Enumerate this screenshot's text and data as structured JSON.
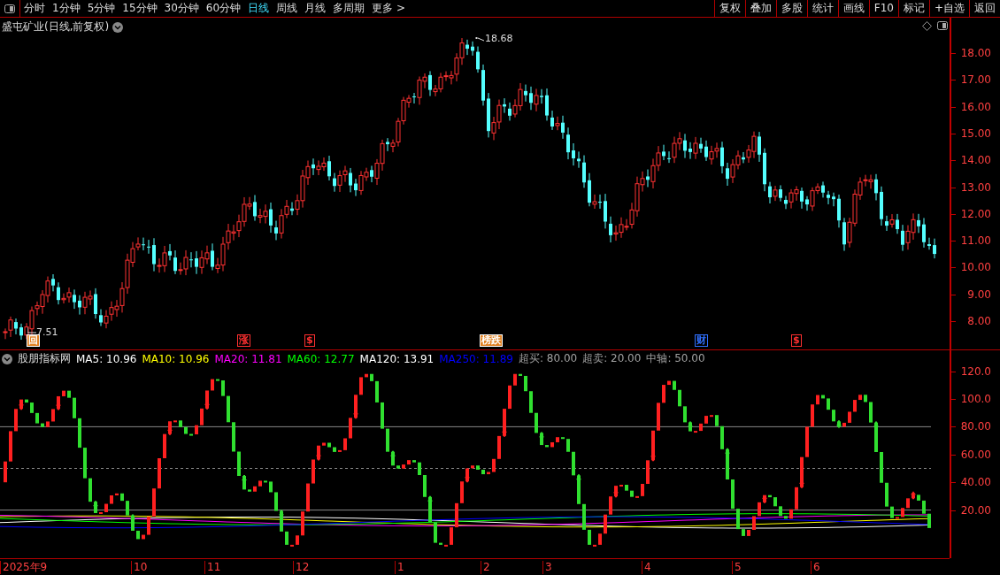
{
  "toolbar": {
    "periods": [
      {
        "label": "分时",
        "selected": false
      },
      {
        "label": "1分钟",
        "selected": false
      },
      {
        "label": "5分钟",
        "selected": false
      },
      {
        "label": "15分钟",
        "selected": false
      },
      {
        "label": "30分钟",
        "selected": false
      },
      {
        "label": "60分钟",
        "selected": false
      },
      {
        "label": "日线",
        "selected": true
      },
      {
        "label": "周线",
        "selected": false
      },
      {
        "label": "月线",
        "selected": false
      },
      {
        "label": "多周期",
        "selected": false
      },
      {
        "label": "更多 >",
        "selected": false
      }
    ],
    "buttons": [
      "复权",
      "叠加",
      "多股",
      "统计",
      "画线",
      "F10",
      "标记",
      "+自选",
      "返回"
    ]
  },
  "price_chart": {
    "title": "盛屯矿业(日线,前复权)",
    "high_label": "18.68",
    "low_label": "7.51",
    "axis_ticks": [
      "18.00",
      "17.00",
      "16.00",
      "15.00",
      "14.00",
      "13.00",
      "12.00",
      "11.00",
      "10.00",
      "9.00",
      "8.00"
    ],
    "events": [
      {
        "text": "回",
        "color": "#e08020"
      },
      {
        "text": "涨",
        "color": "#ff3030"
      },
      {
        "text": "$",
        "color": "#ff3030"
      },
      {
        "text": "榜跌",
        "color": "#e08020"
      },
      {
        "text": "财",
        "color": "#3070ff"
      },
      {
        "text": "$",
        "color": "#ff3030"
      }
    ]
  },
  "indicator": {
    "name": "股朋指标网",
    "fields": [
      {
        "text": "MA5: 10.96",
        "color": "#ffffff"
      },
      {
        "text": "MA10: 10.96",
        "color": "#ffff00"
      },
      {
        "text": "MA20: 11.81",
        "color": "#ff00ff"
      },
      {
        "text": "MA60: 12.77",
        "color": "#00ff00"
      },
      {
        "text": "MA120: 13.91",
        "color": "#ffffff"
      },
      {
        "text": "MA250: 11.89",
        "color": "#0000ff"
      },
      {
        "text": "超买: 80.00",
        "color": "#a0a0a0"
      },
      {
        "text": "超卖: 20.00",
        "color": "#a0a0a0"
      },
      {
        "text": "中轴: 50.00",
        "color": "#a0a0a0"
      }
    ],
    "axis_ticks": [
      "120.0",
      "100.0",
      "80.00",
      "60.00",
      "40.00",
      "20.00"
    ]
  },
  "date_axis": [
    "2025年9",
    "10",
    "11",
    "12",
    "1",
    "2",
    "3",
    "4",
    "5",
    "6"
  ]
}
